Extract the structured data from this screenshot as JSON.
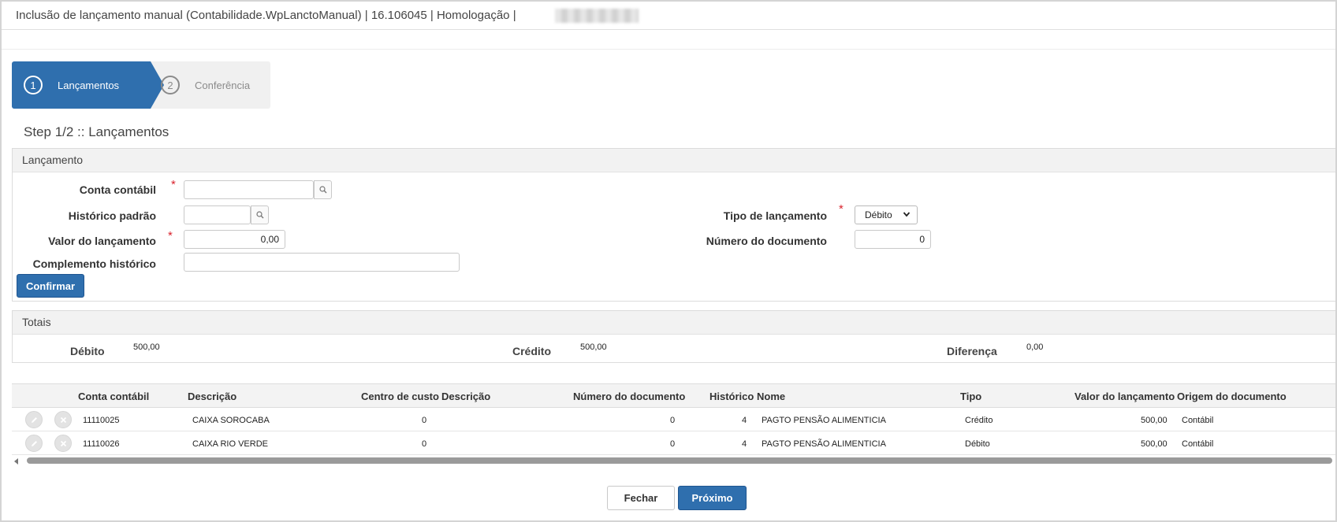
{
  "title_bar": {
    "title": "Inclusão de lançamento manual (Contabilidade.WpLanctoManual) | 16.106045 | Homologação |"
  },
  "stepper": {
    "steps": [
      {
        "number": "1",
        "label": "Lançamentos",
        "active": true
      },
      {
        "number": "2",
        "label": "Conferência",
        "active": false
      }
    ]
  },
  "step_heading": "Step 1/2 :: Lançamentos",
  "lancamento": {
    "panel_title": "Lançamento",
    "conta_contabil": {
      "label": "Conta contábil",
      "value": ""
    },
    "historico_padrao": {
      "label": "Histórico padrão",
      "value": ""
    },
    "valor_lancamento": {
      "label": "Valor do lançamento",
      "value": "0,00"
    },
    "complemento_historico": {
      "label": "Complemento histórico",
      "value": ""
    },
    "tipo_lancamento": {
      "label": "Tipo de lançamento",
      "selected": "Débito"
    },
    "numero_documento": {
      "label": "Número do documento",
      "value": "0"
    },
    "required_mark": "*",
    "confirm_label": "Confirmar"
  },
  "totais": {
    "panel_title": "Totais",
    "debito_label": "Débito",
    "debito_value": "500,00",
    "credito_label": "Crédito",
    "credito_value": "500,00",
    "diferenca_label": "Diferença",
    "diferenca_value": "0,00"
  },
  "grid": {
    "columns": [
      "Conta contábil",
      "Descrição",
      "Centro de custo",
      "Descrição",
      "Número do documento",
      "Histórico",
      "Nome",
      "Tipo",
      "Valor do lançamento",
      "Origem do documento"
    ],
    "rows": [
      {
        "conta": "11110025",
        "descricao": "CAIXA SOROCABA",
        "centro_custo": "0",
        "descricao_cc": "",
        "numero_documento": "0",
        "historico": "4",
        "nome": "PAGTO PENSÃO ALIMENTICIA",
        "tipo": "Crédito",
        "valor": "500,00",
        "origem": "Contábil"
      },
      {
        "conta": "11110026",
        "descricao": "CAIXA RIO VERDE",
        "centro_custo": "0",
        "descricao_cc": "",
        "numero_documento": "0",
        "historico": "4",
        "nome": "PAGTO PENSÃO ALIMENTICIA",
        "tipo": "Débito",
        "valor": "500,00",
        "origem": "Contábil"
      }
    ]
  },
  "footer": {
    "close_label": "Fechar",
    "next_label": "Próximo"
  },
  "colors": {
    "primary": "#2f6fae",
    "required": "#d9232d"
  }
}
